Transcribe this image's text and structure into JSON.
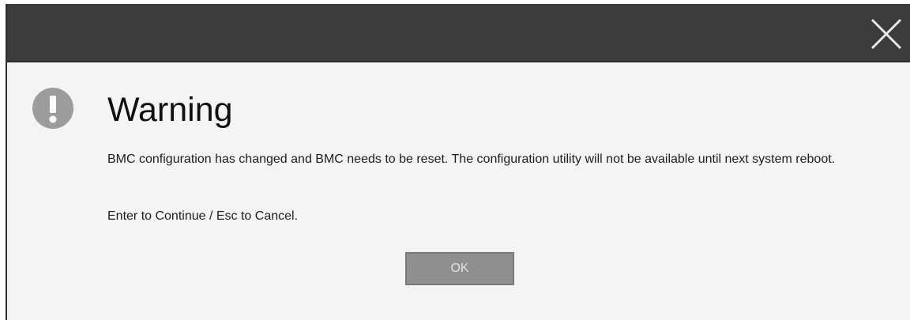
{
  "dialog": {
    "title": "Warning",
    "message": "BMC configuration has changed and BMC needs to be reset. The configuration utility will not be available until next system reboot.",
    "prompt": "Enter to Continue / Esc to Cancel.",
    "ok_label": "OK",
    "icons": {
      "warning": "exclamation-circle-icon",
      "close": "close-icon"
    },
    "colors": {
      "titlebar": "#3c3c3c",
      "background": "#f4f4f4",
      "button": "#8f8f8f",
      "icon": "#9c9c9c"
    }
  }
}
